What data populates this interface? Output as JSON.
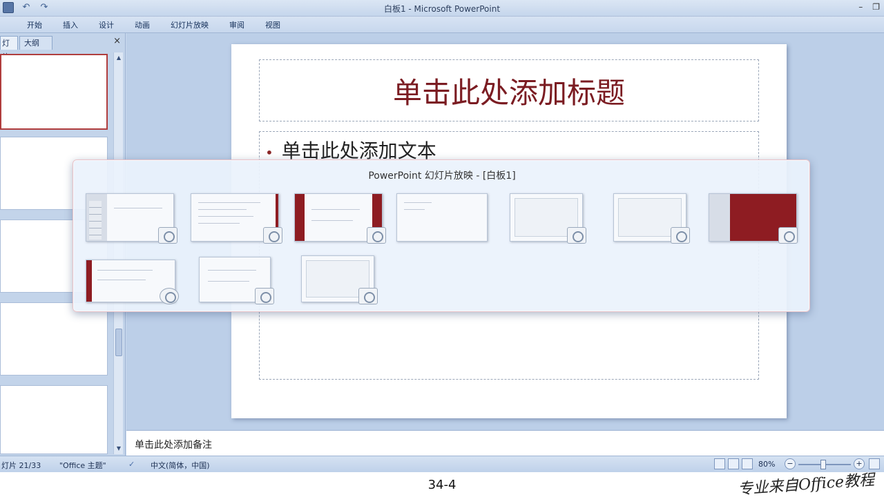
{
  "window": {
    "title": "白板1 - Microsoft PowerPoint",
    "controls": [
      "–",
      "❐"
    ]
  },
  "ribbon": {
    "tabs": [
      "开始",
      "插入",
      "设计",
      "动画",
      "幻灯片放映",
      "审阅",
      "视图"
    ]
  },
  "left_panel": {
    "tab_slides": "灯片",
    "tab_outline": "大纲",
    "close": "×"
  },
  "slide": {
    "title_placeholder": "单击此处添加标题",
    "body_placeholder": "单击此处添加文本",
    "bullet": "•"
  },
  "notes": {
    "placeholder": "单击此处添加备注"
  },
  "switcher": {
    "title": "PowerPoint 幻灯片放映 - [白板1]"
  },
  "statusbar": {
    "slide_counter": "灯片 21/33",
    "theme": "\"Office 主题\"",
    "language": "中文(简体，中国)",
    "zoom": "80%",
    "zoom_minus": "−",
    "zoom_plus": "+"
  },
  "video": {
    "page_label": "34-4",
    "watermark": "专业来自Office教程"
  },
  "colors": {
    "title_text": "#7b1c22",
    "accent_red": "#8e1c22",
    "ribbon_bg": "#c7d7ed"
  }
}
